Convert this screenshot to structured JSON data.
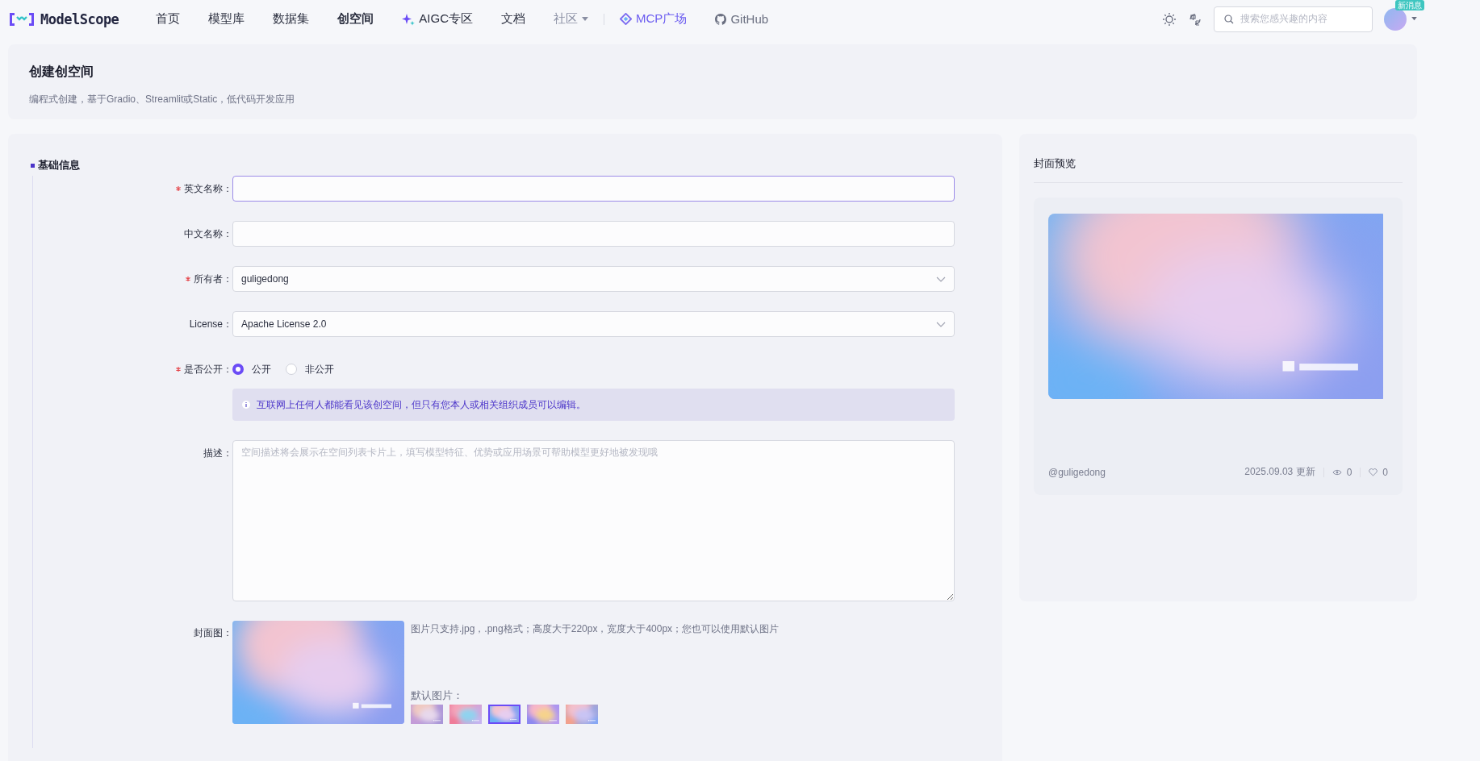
{
  "nav": {
    "brand": "ModelScope",
    "items": [
      {
        "label": "首页",
        "kind": "plain",
        "selected": false
      },
      {
        "label": "模型库",
        "kind": "plain",
        "selected": false
      },
      {
        "label": "数据集",
        "kind": "plain",
        "selected": false
      },
      {
        "label": "创空间",
        "kind": "plain",
        "selected": true
      },
      {
        "label": "AIGC专区",
        "kind": "sparkle",
        "selected": false
      },
      {
        "label": "文档",
        "kind": "plain",
        "selected": false
      },
      {
        "label": "社区",
        "kind": "dropdown",
        "selected": false
      },
      {
        "label": "MCP广场",
        "kind": "diamond",
        "selected": false
      },
      {
        "label": "GitHub",
        "kind": "github",
        "selected": false
      }
    ],
    "search": {
      "placeholder": "搜索您感兴趣的内容"
    },
    "badge": "新消息"
  },
  "header": {
    "title": "创建创空间",
    "subtitle": "编程式创建，基于Gradio、Streamlit或Static，低代码开发应用"
  },
  "form": {
    "section": "基础信息",
    "fields": [
      {
        "label": "英文名称：",
        "kind": "input",
        "required": true,
        "focused": true
      },
      {
        "label": "中文名称：",
        "kind": "input",
        "required": false,
        "focused": false
      },
      {
        "label": "所有者：",
        "kind": "select",
        "required": true,
        "focused": false,
        "value": "guligedong"
      },
      {
        "label": "License：",
        "kind": "select",
        "required": false,
        "focused": false,
        "value": "Apache License 2.0"
      },
      {
        "label": "是否公开：",
        "kind": "radio",
        "required": true,
        "options": [
          {
            "label": "公开",
            "selected": true
          },
          {
            "label": "非公开",
            "selected": false
          }
        ],
        "notice": "互联网上任何人都能看见该创空间，但只有您本人或相关组织成员可以编辑。"
      },
      {
        "label": "描述：",
        "kind": "textarea",
        "required": false,
        "focused": false,
        "placeholder": "空间描述将会展示在空间列表卡片上，填写模型特征、优势或应用场景可帮助模型更好地被发现哦"
      },
      {
        "label": "封面图：",
        "kind": "cover",
        "required": false,
        "hint": "图片只支持.jpg，.png格式；高度大于220px，宽度大于400px；您也可以使用默认图片",
        "defaults_label": "默认图片：",
        "thumbnails": [
          {
            "selected": false
          },
          {
            "selected": false
          },
          {
            "selected": true
          },
          {
            "selected": false
          },
          {
            "selected": false
          }
        ]
      }
    ]
  },
  "preview": {
    "title": "封面预览",
    "owner": "@guligedong",
    "updated": "2025.09.03 更新",
    "views": "0",
    "likes": "0"
  }
}
